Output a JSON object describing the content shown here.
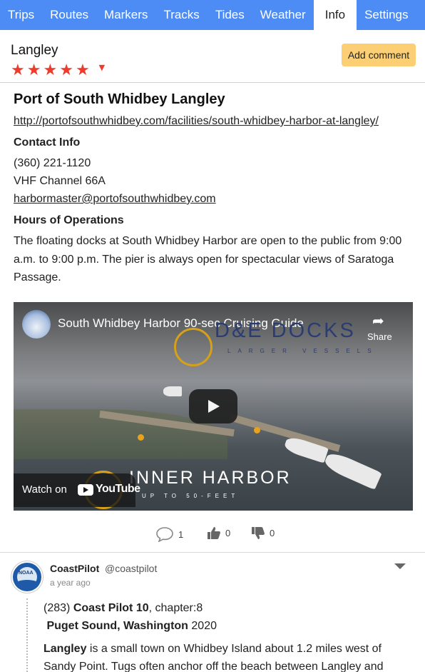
{
  "tabs": [
    {
      "label": "Trips",
      "active": false
    },
    {
      "label": "Routes",
      "active": false
    },
    {
      "label": "Markers",
      "active": false
    },
    {
      "label": "Tracks",
      "active": false
    },
    {
      "label": "Tides",
      "active": false
    },
    {
      "label": "Weather",
      "active": false
    },
    {
      "label": "Info",
      "active": true
    },
    {
      "label": "Settings",
      "active": false
    }
  ],
  "header": {
    "location_name": "Langley",
    "rating": 5,
    "rating_max": 5,
    "add_comment_label": "Add comment"
  },
  "info": {
    "title": "Port of South Whidbey Langley",
    "website": "http://portofsouthwhidbey.com/facilities/south-whidbey-harbor-at-langley/",
    "contact_heading": "Contact Info",
    "phone": "(360) 221-1120",
    "vhf": "VHF Channel 66A",
    "email": "harbormaster@portofsouthwhidbey.com",
    "hours_heading": "Hours of Operations",
    "hours_text": "The floating docks at South Whidbey Harbor are open to the public from 9:00 a.m. to 9:00 p.m. The pier is always open for spectacular views of Saratoga Passage."
  },
  "video": {
    "title": "South Whidbey Harbor 90-sec Cruising Guide",
    "share_label": "Share",
    "overlay_top": "D&E DOCKS",
    "overlay_top_sub": "LARGER VESSELS",
    "overlay_bottom": "INNER HARBOR",
    "overlay_bottom_sub": "UP TO 50-FEET",
    "watch_on_label": "Watch on",
    "youtube_label": "YouTube"
  },
  "stats": {
    "comments": "1",
    "likes": "0",
    "dislikes": "0"
  },
  "comment": {
    "user": "CoastPilot",
    "handle": "@coastpilot",
    "time": "a year ago",
    "avatar_text": "NOAA",
    "ref_number": "(283)",
    "ref_book": "Coast Pilot 10",
    "ref_chapter": ", chapter:8",
    "ref_region": "Puget Sound, Washington",
    "ref_year": " 2020",
    "body_strong": "Langley",
    "body_text": " is a small town on Whidbey Island about 1.2 miles west of Sandy Point. Tugs often anchor off the beach between Langley and"
  },
  "colors": {
    "tabbar": "#4d8cf5",
    "star": "#ef3b2d",
    "add_comment_bg": "#fccf75"
  }
}
